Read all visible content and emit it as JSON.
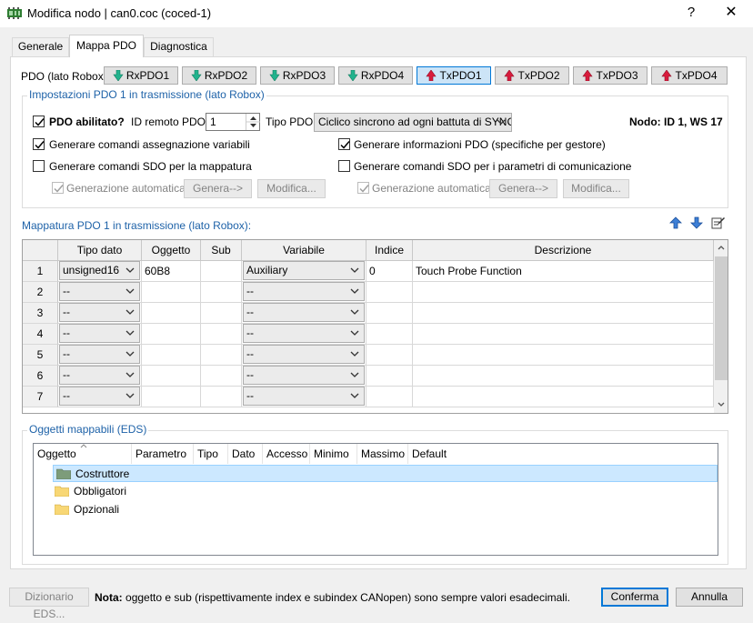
{
  "window": {
    "title": "Modifica nodo | can0.coc (coced-1)",
    "help": "?",
    "close": "✕"
  },
  "tabs": [
    {
      "label": "Generale"
    },
    {
      "label": "Mappa PDO"
    },
    {
      "label": "Diagnostica"
    }
  ],
  "pdo_bar": {
    "label": "PDO (lato Robox):",
    "buttons": [
      {
        "label": "RxPDO1"
      },
      {
        "label": "RxPDO2"
      },
      {
        "label": "RxPDO3"
      },
      {
        "label": "RxPDO4"
      },
      {
        "label": "TxPDO1"
      },
      {
        "label": "TxPDO2"
      },
      {
        "label": "TxPDO3"
      },
      {
        "label": "TxPDO4"
      }
    ]
  },
  "settings": {
    "title": "Impostazioni PDO 1 in trasmissione (lato Robox)",
    "enabled_label": "PDO abilitato?",
    "remote_id_label": "ID remoto PDO:",
    "remote_id_value": "1",
    "type_label": "Tipo PDO:",
    "type_value": "Ciclico sincrono ad ogni battuta di SYNC",
    "node_label": "Nodo: ID 1, WS 17",
    "assign_cmds": "Generare comandi assegnazione variabili",
    "pdo_info": "Generare informazioni PDO (specifiche per gestore)",
    "sdo_mapping": "Generare comandi SDO per la mappatura",
    "sdo_comm": "Generare comandi SDO per i parametri di comunicazione",
    "auto_gen": "Generazione automatica",
    "generate_btn": "Genera-->",
    "modify_btn": "Modifica..."
  },
  "mapping": {
    "title": "Mappatura PDO 1 in trasmissione (lato Robox):",
    "columns": [
      "Tipo dato",
      "Oggetto",
      "Sub",
      "Variabile",
      "Indice",
      "Descrizione"
    ],
    "rows": [
      {
        "num": "1",
        "type": "unsigned16",
        "object": "60B8",
        "sub": "",
        "variable": "Auxiliary",
        "index": "0",
        "description": "Touch Probe Function"
      },
      {
        "num": "2",
        "type": "--",
        "object": "",
        "sub": "",
        "variable": "--",
        "index": "",
        "description": ""
      },
      {
        "num": "3",
        "type": "--",
        "object": "",
        "sub": "",
        "variable": "--",
        "index": "",
        "description": ""
      },
      {
        "num": "4",
        "type": "--",
        "object": "",
        "sub": "",
        "variable": "--",
        "index": "",
        "description": ""
      },
      {
        "num": "5",
        "type": "--",
        "object": "",
        "sub": "",
        "variable": "--",
        "index": "",
        "description": ""
      },
      {
        "num": "6",
        "type": "--",
        "object": "",
        "sub": "",
        "variable": "--",
        "index": "",
        "description": ""
      },
      {
        "num": "7",
        "type": "--",
        "object": "",
        "sub": "",
        "variable": "--",
        "index": "",
        "description": ""
      }
    ]
  },
  "eds": {
    "title": "Oggetti mappabili (EDS)",
    "columns": [
      "Oggetto",
      "Parametro",
      "Tipo",
      "Dato",
      "Accesso",
      "Minimo",
      "Massimo",
      "Default"
    ],
    "items": [
      {
        "label": "Costruttore"
      },
      {
        "label": "Obbligatori"
      },
      {
        "label": "Opzionali"
      }
    ]
  },
  "footer": {
    "dictionary_btn": "Dizionario EDS...",
    "note_bold": "Nota:",
    "note_text": "oggetto e sub (rispettivamente index e subindex CANopen) sono sempre valori esadecimali.",
    "confirm_btn": "Conferma",
    "cancel_btn": "Annulla"
  },
  "colors": {
    "accent": "#0078d7",
    "group_title": "#1e62a8",
    "rx_arrow": "#21b38d",
    "tx_arrow": "#d81b3c",
    "folder": "#f8d775"
  }
}
